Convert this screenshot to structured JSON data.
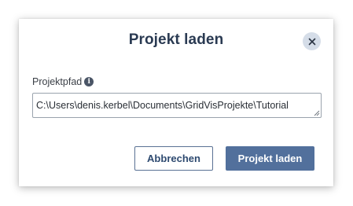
{
  "dialog": {
    "title": "Projekt laden",
    "close_icon": "close-icon",
    "field": {
      "label": "Projektpfad",
      "info_icon": "info-icon",
      "info_glyph": "i",
      "value": "C:\\Users\\denis.kerbel\\Documents\\GridVisProjekte\\Tutorial"
    },
    "buttons": {
      "cancel_label": "Abbrechen",
      "confirm_label": "Projekt laden"
    }
  },
  "colors": {
    "title": "#2a3a52",
    "primary": "#52709c",
    "close_bg": "#d5dde8"
  }
}
